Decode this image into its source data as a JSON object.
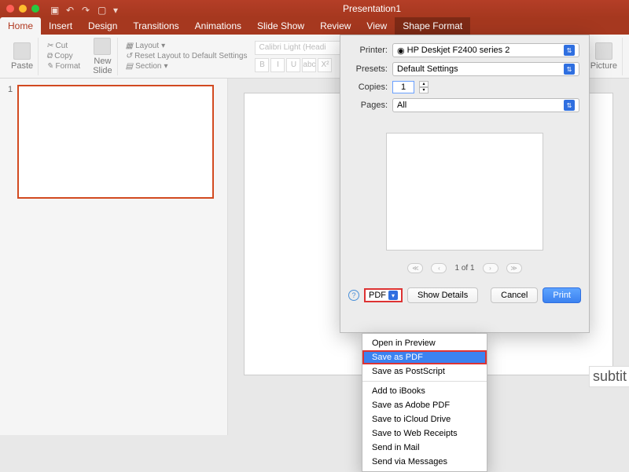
{
  "title": "Presentation1",
  "tabs": [
    "Home",
    "Insert",
    "Design",
    "Transitions",
    "Animations",
    "Slide Show",
    "Review",
    "View",
    "Shape Format"
  ],
  "ribbon": {
    "paste": "Paste",
    "cut": "Cut",
    "copy": "Copy",
    "format": "Format",
    "newslide": "New\nSlide",
    "layout": "Layout",
    "reset": "Reset Layout to Default Settings",
    "section": "Section",
    "font_name": "Calibri Light (Headi",
    "picture": "Picture"
  },
  "thumb": {
    "num": "1"
  },
  "subtitle_hint": "subtit",
  "print": {
    "printer_label": "Printer:",
    "printer_value": "HP Deskjet F2400 series 2",
    "presets_label": "Presets:",
    "presets_value": "Default Settings",
    "copies_label": "Copies:",
    "copies_value": "1",
    "pages_label": "Pages:",
    "pages_value": "All",
    "page_of": "1 of 1",
    "pdf_btn": "PDF",
    "show_details": "Show Details",
    "cancel": "Cancel",
    "print_btn": "Print"
  },
  "pdf_menu": {
    "items_top": [
      "Open in Preview",
      "Save as PDF",
      "Save as PostScript"
    ],
    "items_bottom": [
      "Add to iBooks",
      "Save as Adobe PDF",
      "Save to iCloud Drive",
      "Save to Web Receipts",
      "Send in Mail",
      "Send via Messages"
    ],
    "selected": "Save as PDF"
  }
}
